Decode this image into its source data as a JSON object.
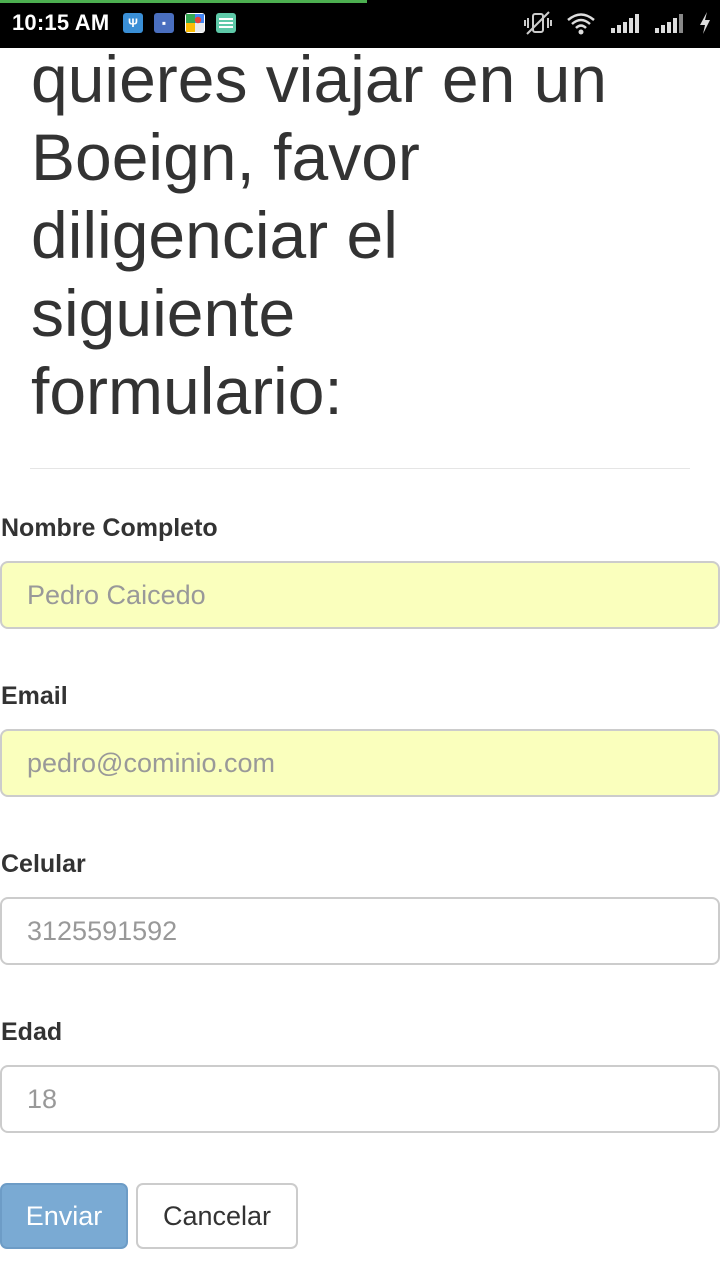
{
  "status_bar": {
    "time": "10:15 AM",
    "page_load_progress": 0.51,
    "notification_icons": [
      "usb-debug-icon",
      "note-app-icon",
      "maps-icon",
      "keyboard-icon"
    ],
    "system_icons": [
      "vibrate-off-icon",
      "wifi-icon",
      "signal-icon",
      "signal-2-icon",
      "charging-icon"
    ]
  },
  "heading": {
    "text": "quieres viajar en un\nBoeign, favor\ndiligenciar el\nsiguiente\nformulario:"
  },
  "form": {
    "fields": [
      {
        "label": "Nombre Completo",
        "placeholder": "Pedro Caicedo",
        "autofilled": true
      },
      {
        "label": "Email",
        "placeholder": "pedro@cominio.com",
        "autofilled": true
      },
      {
        "label": "Celular",
        "placeholder": "3125591592",
        "autofilled": false
      },
      {
        "label": "Edad",
        "placeholder": "18",
        "autofilled": false
      }
    ],
    "submit_label": "Enviar",
    "cancel_label": "Cancelar"
  },
  "colors": {
    "autofill_background": "#faffbd",
    "primary_button": "#7aaad3",
    "heading_text": "#333333",
    "progress": "#4caf50"
  }
}
